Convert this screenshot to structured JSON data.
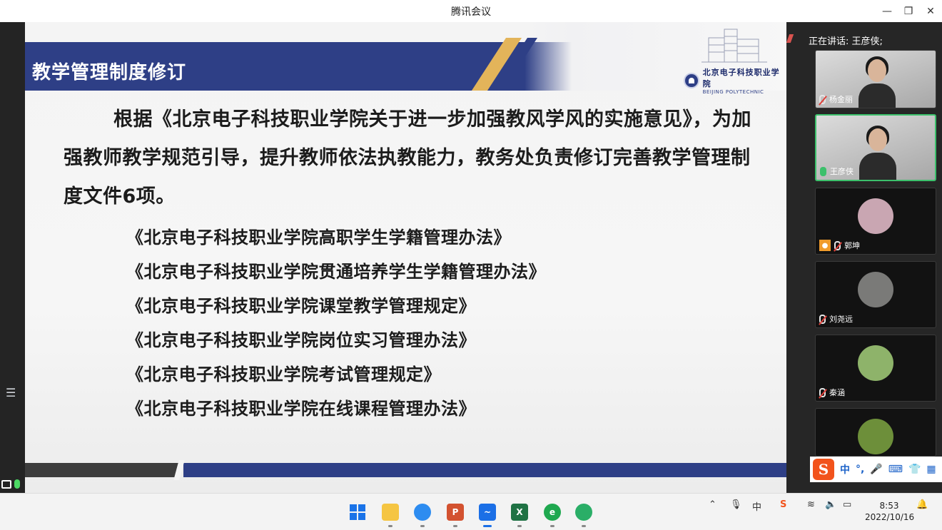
{
  "window": {
    "title": "腾讯会议",
    "minimize": "—",
    "restore": "❐",
    "close": "✕"
  },
  "speaker_bar": {
    "text": "正在讲话: 王彦侠;"
  },
  "slide": {
    "heading": "教学管理制度修订",
    "logo_cn": "北京电子科技职业学院",
    "logo_en": "BEIJING POLYTECHNIC",
    "paragraph": "根据《北京电子科技职业学院关于进一步加强教风学风的实施意见》，为加强教师教学规范引导，提升教师依法执教能力，教务处负责修订完善教学管理制度文件6项。",
    "documents": [
      "《北京电子科技职业学院高职学生学籍管理办法》",
      "《北京电子科技职业学院贯通培养学生学籍管理办法》",
      "《北京电子科技职业学院课堂教学管理规定》",
      "《北京电子科技职业学院岗位实习管理办法》",
      "《北京电子科技职业学院考试管理规定》",
      "《北京电子科技职业学院在线课程管理办法》"
    ]
  },
  "participants": [
    {
      "name": "杨金丽",
      "mic": "off",
      "video": true
    },
    {
      "name": "王彦侠",
      "mic": "on",
      "video": true,
      "active": true
    },
    {
      "name": "郭坤",
      "mic": "off",
      "video": false,
      "host_badge": true,
      "avatar_color": "#c9a6b2"
    },
    {
      "name": "刘尧远",
      "mic": "off",
      "video": false,
      "avatar_color": "#7a7a78"
    },
    {
      "name": "秦涵",
      "mic": "off",
      "video": false,
      "avatar_color": "#8eb36a"
    },
    {
      "name": "",
      "mic": "off",
      "video": false,
      "avatar_color": "#6d8f3a"
    }
  ],
  "ime": {
    "logo": "S",
    "mode": "中",
    "punct": "°,",
    "items": [
      "🎤",
      "⌨",
      "👕",
      "▦"
    ]
  },
  "taskbar": {
    "tray_mode": "中",
    "time": "8:53",
    "date": "2022/10/16"
  },
  "colors": {
    "slide_blue": "#2e3f86",
    "slide_gold": "#e3b45a",
    "active_green": "#3cc06b"
  }
}
